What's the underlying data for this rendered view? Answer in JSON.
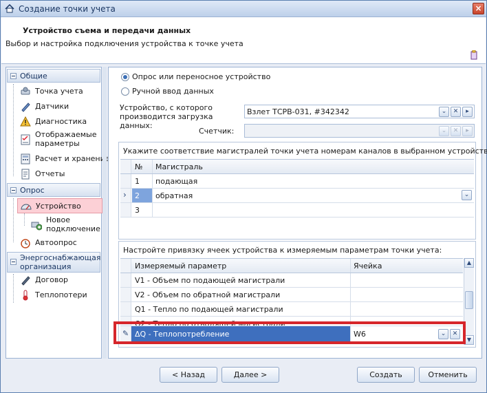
{
  "window": {
    "title": "Создание точки учета"
  },
  "header": {
    "title": "Устройство съема и передачи данных",
    "subtitle": "Выбор и настройка подключения устройства к точке учета"
  },
  "nav": {
    "groups": [
      {
        "label": "Общие",
        "items": [
          "Точка учета",
          "Датчики",
          "Диагностика",
          "Отображаемые параметры",
          "Расчет и хранение",
          "Отчеты"
        ]
      },
      {
        "label": "Опрос",
        "items": [
          "Устройство",
          "Новое подключение",
          "Автоопрос"
        ]
      },
      {
        "label": "Энергоснабжающая организация",
        "items": [
          "Договор",
          "Теплопотери"
        ]
      }
    ],
    "selected": "Устройство"
  },
  "main": {
    "radio_poll": "Опрос или переносное устройство",
    "radio_manual": "Ручной ввод данных",
    "device_label": "Устройство, с которого производится загрузка данных:",
    "device_value": "Взлет ТСРВ-031, #342342",
    "meter_label": "Счетчик:",
    "meter_value": "",
    "channels": {
      "title": "Укажите соответствие магистралей точки учета номерам каналов в выбранном устройстве:",
      "columns": [
        "№",
        "Магистраль"
      ],
      "rows": [
        {
          "num": "1",
          "main": "подающая"
        },
        {
          "num": "2",
          "main": "обратная"
        },
        {
          "num": "3",
          "main": ""
        }
      ]
    },
    "params": {
      "title": "Настройте привязку ячеек устройства к измеряемым параметрам точки учета:",
      "columns": [
        "Измеряемый параметр",
        "Ячейка"
      ],
      "rows": [
        {
          "param": "V1 - Объем по подающей магистрали",
          "cell": ""
        },
        {
          "param": "V2 - Объем по обратной магистрали",
          "cell": ""
        },
        {
          "param": "Q1 - Тепло по подающей магистрали",
          "cell": ""
        },
        {
          "param": "Q2 - Тепло по отводящей магистрали",
          "cell": ""
        },
        {
          "param": "ΔQ - Теплопотребление",
          "cell": "W6"
        }
      ]
    }
  },
  "footer": {
    "back": "< Назад",
    "next": "Далее >",
    "create": "Создать",
    "cancel": "Отменить"
  },
  "colors": {
    "selected_row": "#3e6fbe",
    "highlight_border": "#d6262b",
    "nav_selected": "#fcd0d6"
  }
}
